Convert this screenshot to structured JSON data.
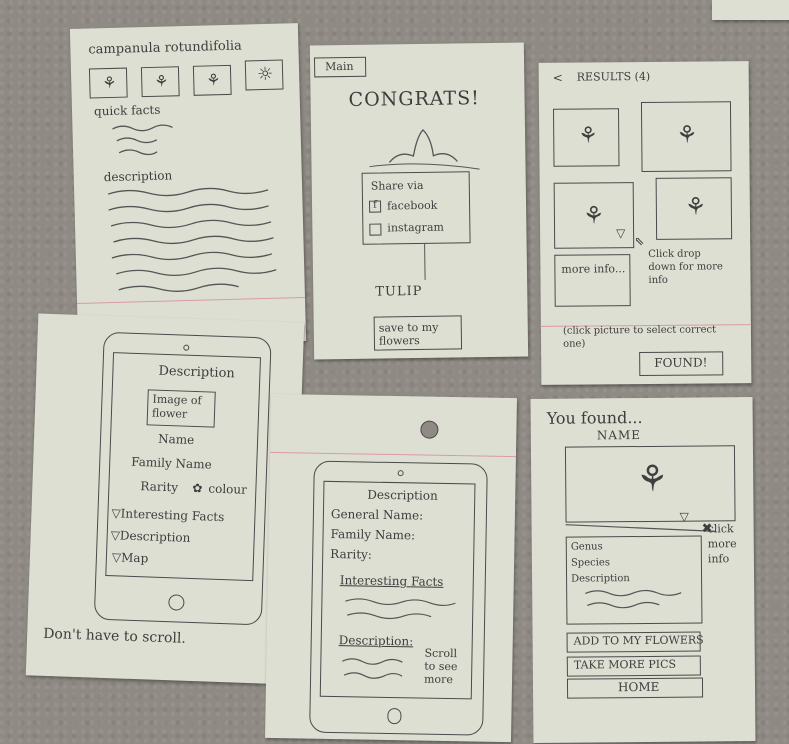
{
  "corner_scrap": {},
  "sketch_1": {
    "header": "campanula rotundifolia",
    "quick_facts": "quick facts",
    "description": "description"
  },
  "sketch_2": {
    "tab": "Main",
    "title": "CONGRATS!",
    "share_via": "Share via",
    "facebook_icon": "f",
    "facebook": "facebook",
    "instagram": "instagram",
    "flower_name": "TULIP",
    "save_button": "save to my flowers"
  },
  "sketch_3": {
    "back": "<",
    "results": "RESULTS (4)",
    "more_info": "more info...",
    "click_note": "Click drop down for more info",
    "select_note": "(click picture to select correct one)",
    "found_button": "FOUND!"
  },
  "sketch_4": {
    "title": "Description",
    "image_label": "Image of flower",
    "name": "Name",
    "family_name": "Family Name",
    "rarity": "Rarity",
    "colour": "colour",
    "interesting_facts": "▽Interesting Facts",
    "description": "▽Description",
    "map": "▽Map",
    "note": "Don't have to scroll."
  },
  "sketch_5": {
    "title": "Description",
    "general_name": "General Name:",
    "family_name": "Family Name:",
    "rarity": "Rarity:",
    "interesting_facts": "Interesting Facts",
    "description": "Description:",
    "scroll_note": "Scroll to see more"
  },
  "sketch_6": {
    "title": "You found...",
    "name": "NAME",
    "click_note": "click more info",
    "genus": "Genus",
    "species": "Species",
    "description": "Description",
    "add_button": "ADD TO MY FLOWERS",
    "pics_button": "TAKE MORE PICS",
    "home_button": "HOME"
  }
}
